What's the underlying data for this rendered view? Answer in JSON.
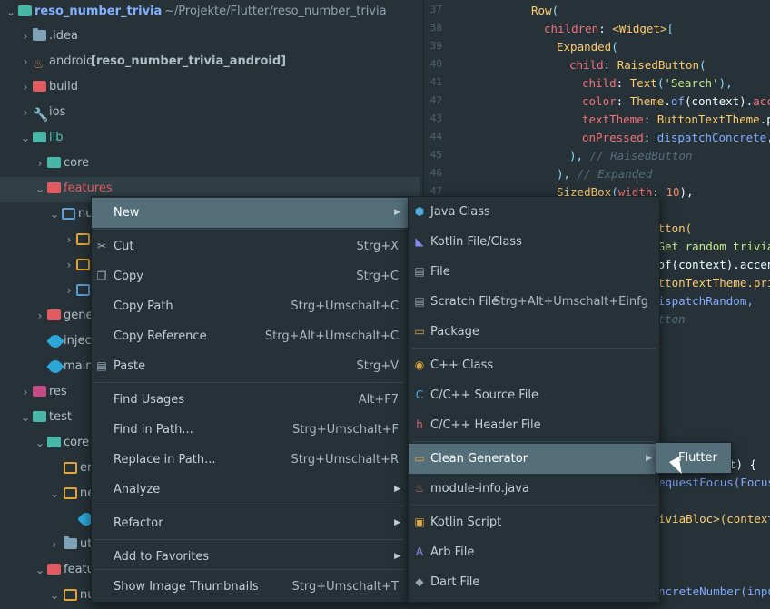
{
  "project_tree": {
    "root_name": "reso_number_trivia",
    "root_path": "~/Projekte/Flutter/reso_number_trivia",
    "items": [
      {
        "label": ".idea"
      },
      {
        "label": "android",
        "extra": "[reso_number_trivia_android]"
      },
      {
        "label": "build"
      },
      {
        "label": "ios"
      },
      {
        "label": "lib"
      },
      {
        "label": "core"
      },
      {
        "label": "features"
      },
      {
        "label": "nu"
      },
      {
        "label": ""
      },
      {
        "label": ""
      },
      {
        "label": ""
      },
      {
        "label": "gene"
      },
      {
        "label": "injec"
      },
      {
        "label": "main"
      },
      {
        "label": "res"
      },
      {
        "label": "test"
      },
      {
        "label": "core"
      },
      {
        "label": "er"
      },
      {
        "label": "ne"
      },
      {
        "label": ""
      },
      {
        "label": "ut"
      },
      {
        "label": "featu"
      },
      {
        "label": "nu"
      }
    ]
  },
  "editor": {
    "line_numbers": [
      "37",
      "38",
      "39",
      "40",
      "41",
      "42",
      "43",
      "44",
      "45",
      "46",
      "47"
    ],
    "lines": [
      [
        {
          "t": "Row",
          "c": "cls"
        },
        {
          "t": "(",
          "c": "br"
        }
      ],
      [
        {
          "t": "children",
          "c": "prop"
        },
        {
          "t": ": ",
          "c": ""
        },
        {
          "t": "<Widget>",
          "c": "cls"
        },
        {
          "t": "[",
          "c": "br"
        }
      ],
      [
        {
          "t": "Expanded",
          "c": "cls"
        },
        {
          "t": "(",
          "c": "br"
        }
      ],
      [
        {
          "t": "child",
          "c": "prop"
        },
        {
          "t": ": ",
          "c": ""
        },
        {
          "t": "RaisedButton",
          "c": "cls"
        },
        {
          "t": "(",
          "c": "br"
        }
      ],
      [
        {
          "t": "child",
          "c": "prop"
        },
        {
          "t": ": ",
          "c": ""
        },
        {
          "t": "Text",
          "c": "cls"
        },
        {
          "t": "(",
          "c": "br"
        },
        {
          "t": "'Search'",
          "c": "str"
        },
        {
          "t": "),",
          "c": "br"
        }
      ],
      [
        {
          "t": "color",
          "c": "prop"
        },
        {
          "t": ": ",
          "c": ""
        },
        {
          "t": "Theme",
          "c": "cls"
        },
        {
          "t": ".",
          "c": ""
        },
        {
          "t": "of",
          "c": "fn"
        },
        {
          "t": "(context).",
          "c": ""
        },
        {
          "t": "accen",
          "c": "prop"
        }
      ],
      [
        {
          "t": "textTheme",
          "c": "prop"
        },
        {
          "t": ": ",
          "c": ""
        },
        {
          "t": "ButtonTextTheme",
          "c": "cls"
        },
        {
          "t": ".pri",
          "c": ""
        }
      ],
      [
        {
          "t": "onPressed",
          "c": "prop"
        },
        {
          "t": ": ",
          "c": ""
        },
        {
          "t": "dispatchConcrete",
          "c": "fn"
        },
        {
          "t": ",",
          "c": ""
        }
      ],
      [
        {
          "t": "), ",
          "c": "br"
        },
        {
          "t": "// RaisedButton",
          "c": "cm"
        }
      ],
      [
        {
          "t": "), ",
          "c": "br"
        },
        {
          "t": "// Expanded",
          "c": "cm"
        }
      ],
      [
        {
          "t": "SizedBox",
          "c": "cls"
        },
        {
          "t": "(",
          "c": "br"
        },
        {
          "t": "width",
          "c": "prop"
        },
        {
          "t": ": ",
          "c": ""
        },
        {
          "t": "10",
          "c": "num"
        },
        {
          "t": "),",
          "c": ""
        }
      ]
    ],
    "fragments": [
      {
        "text": "utton(",
        "cls": "cls"
      },
      {
        "text": "'Get random trivia",
        "cls": "str"
      },
      {
        "text": ".of(context).accen",
        "cls": ""
      },
      {
        "text": "uttonTextTheme.pri",
        "cls": "cls"
      },
      {
        "text": "dispatchRandom,",
        "cls": "fn"
      },
      {
        "text": "utton",
        "cls": "cm"
      },
      {
        "text": "t) {",
        "cls": ""
      },
      {
        "text": "equestFocus(FocusN",
        "cls": "fn"
      },
      {
        "text": "iviaBloc>(context)",
        "cls": "cls"
      },
      {
        "text": "ncreteNumber(input",
        "cls": "fn"
      }
    ]
  },
  "context_menu": {
    "items": [
      {
        "label": "New",
        "shortcut": "",
        "submenu": true,
        "highlighted": true,
        "icon": ""
      },
      {
        "label": "Cut",
        "shortcut": "Strg+X",
        "icon": "scissors-icon",
        "glyph": "✂"
      },
      {
        "label": "Copy",
        "shortcut": "Strg+C",
        "icon": "copy-icon",
        "glyph": "❐"
      },
      {
        "label": "Copy Path",
        "shortcut": "Strg+Umschalt+C",
        "icon": ""
      },
      {
        "label": "Copy Reference",
        "shortcut": "Strg+Alt+Umschalt+C",
        "icon": ""
      },
      {
        "label": "Paste",
        "shortcut": "Strg+V",
        "icon": "clipboard-icon",
        "glyph": "▤"
      },
      {
        "label": "Find Usages",
        "shortcut": "Alt+F7",
        "icon": ""
      },
      {
        "label": "Find in Path...",
        "shortcut": "Strg+Umschalt+F",
        "icon": ""
      },
      {
        "label": "Replace in Path...",
        "shortcut": "Strg+Umschalt+R",
        "icon": ""
      },
      {
        "label": "Analyze",
        "shortcut": "",
        "submenu": true,
        "icon": ""
      },
      {
        "label": "Refactor",
        "shortcut": "",
        "submenu": true,
        "icon": ""
      },
      {
        "label": "Add to Favorites",
        "shortcut": "",
        "submenu": true,
        "icon": ""
      },
      {
        "label": "Show Image Thumbnails",
        "shortcut": "Strg+Umschalt+T",
        "icon": ""
      }
    ]
  },
  "new_submenu": {
    "items": [
      {
        "label": "Java Class",
        "icon": "java-class-icon",
        "glyph": "⬢",
        "color": "#4fa8e0"
      },
      {
        "label": "Kotlin File/Class",
        "icon": "kotlin-icon",
        "glyph": "◣",
        "color": "#7f8cf0"
      },
      {
        "label": "File",
        "icon": "file-icon",
        "glyph": "▤",
        "color": "#9aa7ad"
      },
      {
        "label": "Scratch File",
        "shortcut": "Strg+Alt+Umschalt+Einfg",
        "icon": "scratch-file-icon",
        "glyph": "▤",
        "color": "#9aa7ad"
      },
      {
        "label": "Package",
        "icon": "package-icon",
        "glyph": "▭",
        "color": "#e0a43a"
      },
      {
        "label": "C++ Class",
        "icon": "cpp-class-icon",
        "glyph": "◉",
        "color": "#e0a43a"
      },
      {
        "label": "C/C++ Source File",
        "icon": "c-source-icon",
        "glyph": "C",
        "color": "#4fa8e0"
      },
      {
        "label": "C/C++ Header File",
        "icon": "c-header-icon",
        "glyph": "h",
        "color": "#e25b63"
      },
      {
        "label": "Clean Generator",
        "submenu": true,
        "highlighted": true,
        "icon": "folder-icon",
        "glyph": "▭",
        "color": "#e0a43a"
      },
      {
        "label": "module-info.java",
        "icon": "java-file-icon",
        "glyph": "♨",
        "color": "#c6744e"
      },
      {
        "label": "Kotlin Script",
        "icon": "kotlin-script-icon",
        "glyph": "▣",
        "color": "#e0a43a"
      },
      {
        "label": "Arb File",
        "icon": "arb-file-icon",
        "glyph": "A",
        "color": "#7f8cf0"
      },
      {
        "label": "Dart File",
        "icon": "dart-file-icon",
        "glyph": "◆",
        "color": "#9aa7ad"
      }
    ]
  },
  "clean_generator_submenu": {
    "items": [
      {
        "label": "Flutter"
      }
    ]
  }
}
